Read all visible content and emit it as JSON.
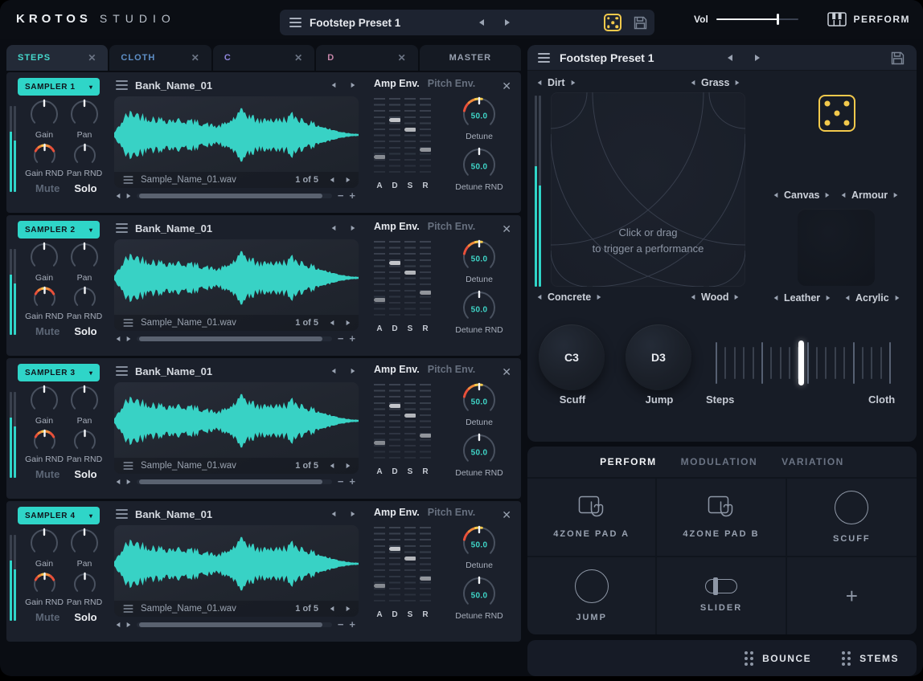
{
  "app": {
    "brand_primary": "KROTOS",
    "brand_secondary": "STUDIO"
  },
  "icons": {
    "menu": "hamburger",
    "close": "✕",
    "minus": "−",
    "plus": "+",
    "caret_down": "▾",
    "plus_cell": "+"
  },
  "top_bar": {
    "preset_name": "Footstep Preset 1",
    "vol_label": "Vol",
    "vol_value_pct": 75,
    "perform_label": "PERFORM"
  },
  "left_tabs": [
    {
      "label": "STEPS",
      "active": true,
      "closable": true,
      "color": "#45D8CC"
    },
    {
      "label": "CLOTH",
      "active": false,
      "closable": true,
      "color": "#5E8FC6"
    },
    {
      "label": "C",
      "active": false,
      "closable": true,
      "color": "#8F86DB"
    },
    {
      "label": "D",
      "active": false,
      "closable": true,
      "color": "#C585A8"
    },
    {
      "label": "MASTER",
      "active": false,
      "closable": false,
      "color": "#98A1B0"
    }
  ],
  "sampler_shared": {
    "gain": "Gain",
    "pan": "Pan",
    "gain_rnd": "Gain RND",
    "pan_rnd": "Pan RND",
    "mute": "Mute",
    "solo": "Solo",
    "amp_env": "Amp Env.",
    "pitch_env": "Pitch Env.",
    "adsr": [
      "A",
      "D",
      "S",
      "R"
    ],
    "adsr_positions": [
      0.74,
      0.28,
      0.4,
      0.65
    ],
    "detune_label": "Detune",
    "detune_rnd_label": "Detune RND"
  },
  "samplers": [
    {
      "label": "SAMPLER 1",
      "bank_name": "Bank_Name_01",
      "sample_name": "Sample_Name_01.wav",
      "page": "1 of 5",
      "detune_value": "50.0",
      "detune_rnd_value": "50.0"
    },
    {
      "label": "SAMPLER 2",
      "bank_name": "Bank_Name_01",
      "sample_name": "Sample_Name_01.wav",
      "page": "1 of 5",
      "detune_value": "50.0",
      "detune_rnd_value": "50.0"
    },
    {
      "label": "SAMPLER 3",
      "bank_name": "Bank_Name_01",
      "sample_name": "Sample_Name_01.wav",
      "page": "1 of 5",
      "detune_value": "50.0",
      "detune_rnd_value": "50.0"
    },
    {
      "label": "SAMPLER 4",
      "bank_name": "Bank_Name_01",
      "sample_name": "Sample_Name_01.wav",
      "page": "1 of 5",
      "detune_value": "50.0",
      "detune_rnd_value": "50.0"
    }
  ],
  "right_panel": {
    "preset_name": "Footstep Preset 1",
    "xy_pad": {
      "top_left": "Dirt",
      "top_right": "Grass",
      "bottom_left": "Concrete",
      "bottom_right": "Wood",
      "hint_line1": "Click or drag",
      "hint_line2": "to trigger a performance"
    },
    "material_pad": {
      "top_left": "Canvas",
      "top_right": "Armour",
      "bottom_left": "Leather",
      "bottom_right": "Acrylic"
    },
    "trigger_pads": [
      {
        "note": "C3",
        "label": "Scuff"
      },
      {
        "note": "D3",
        "label": "Jump"
      }
    ],
    "morph_slider": {
      "left_label": "Steps",
      "right_label": "Cloth",
      "value_pct": 49
    },
    "tabs": [
      {
        "label": "PERFORM",
        "active": true
      },
      {
        "label": "MODULATION",
        "active": false
      },
      {
        "label": "VARIATION",
        "active": false
      }
    ],
    "cells": [
      {
        "label": "4ZONE PAD A",
        "icon": "touchpad-icon"
      },
      {
        "label": "4ZONE PAD B",
        "icon": "touchpad-icon"
      },
      {
        "label": "SCUFF",
        "icon": "circle-icon"
      },
      {
        "label": "JUMP",
        "icon": "circle-icon"
      },
      {
        "label": "SLIDER",
        "icon": "slider-icon"
      },
      {
        "label": "",
        "icon": "plus-icon"
      }
    ],
    "bounce_label": "BOUNCE",
    "stems_label": "STEMS"
  },
  "colors": {
    "accent_teal": "#2FD5C8",
    "value_teal": "#3FD6C8",
    "accent_yellow": "#F2C94C",
    "rnd_red": "#E8503A",
    "rnd_orange": "#F08A3C",
    "waveform": "#38D2C5"
  }
}
